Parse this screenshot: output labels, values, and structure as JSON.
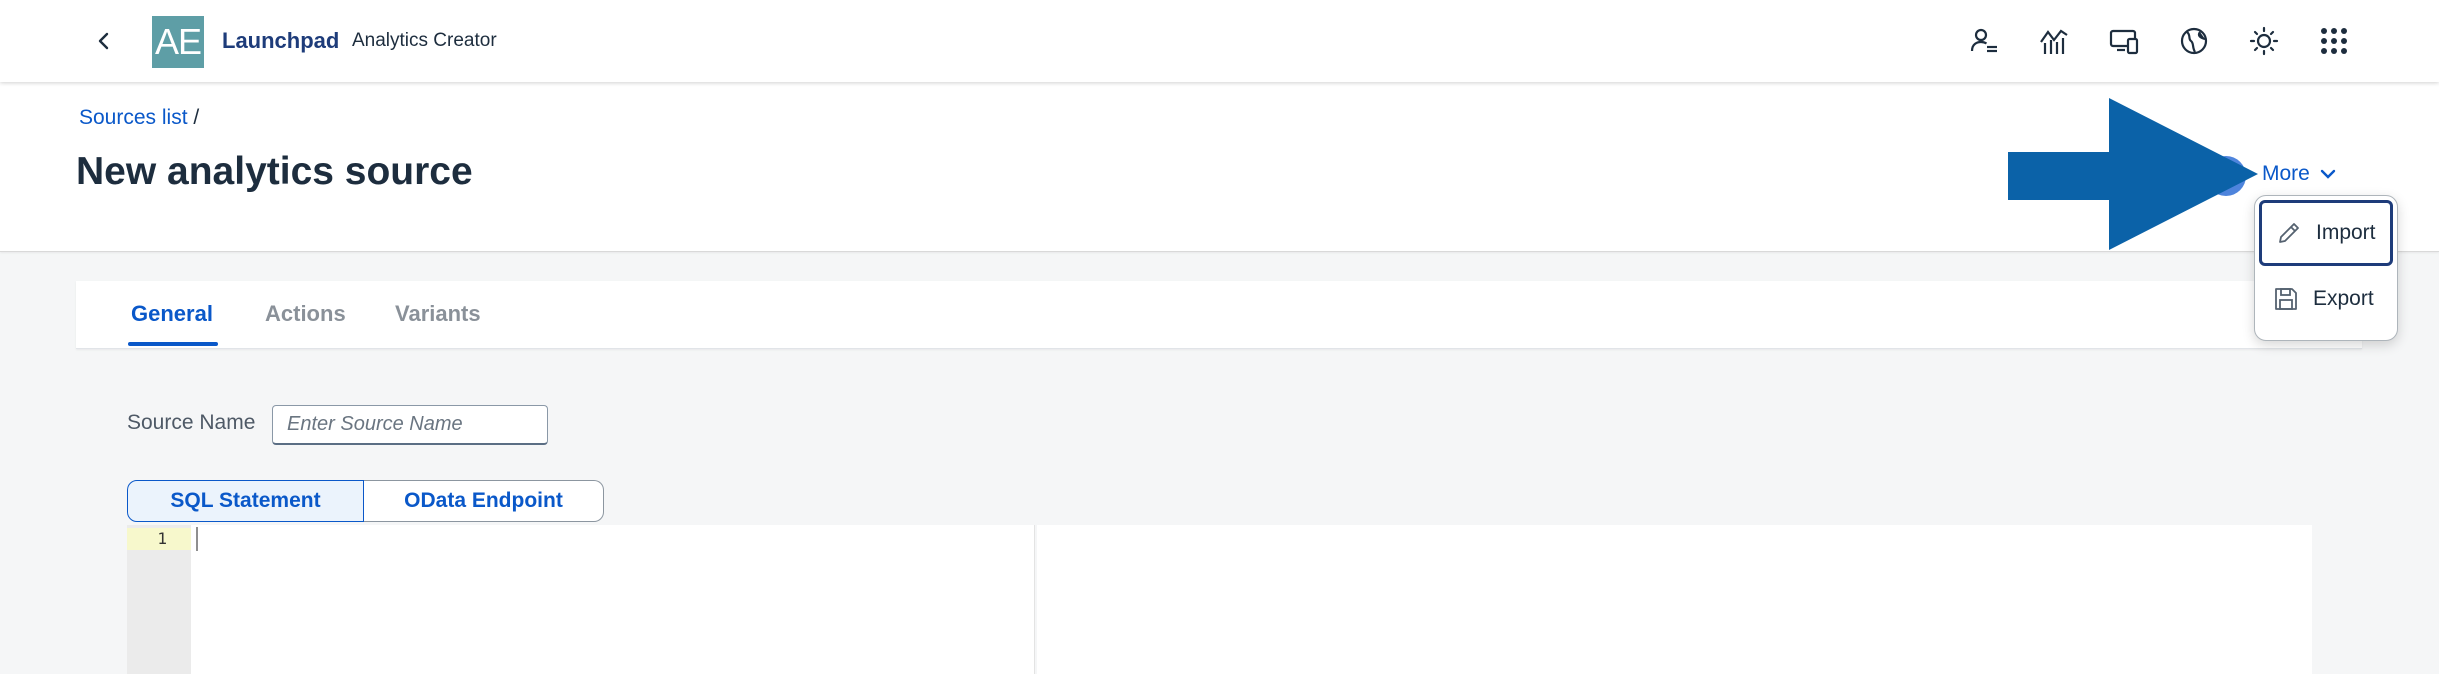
{
  "shell": {
    "logo_text": "AE",
    "product": "Launchpad",
    "subproduct": "Analytics Creator",
    "actions": [
      {
        "icon": "user-list-icon"
      },
      {
        "icon": "analytics-chart-icon"
      },
      {
        "icon": "devices-icon"
      },
      {
        "icon": "globe-icon"
      },
      {
        "icon": "theme-sun-icon"
      },
      {
        "icon": "app-grid-icon"
      }
    ]
  },
  "header": {
    "breadcrumb_link": "Sources list",
    "breadcrumb_sep": "/",
    "title": "New analytics source",
    "more_label": "More"
  },
  "menu": {
    "items": [
      {
        "label": "Import",
        "icon": "pencil-icon"
      },
      {
        "label": "Export",
        "icon": "save-icon"
      }
    ]
  },
  "tabs": [
    {
      "label": "General",
      "active": true
    },
    {
      "label": "Actions",
      "active": false
    },
    {
      "label": "Variants",
      "active": false
    }
  ],
  "form": {
    "source_name_label": "Source Name",
    "source_name_placeholder": "Enter Source Name",
    "source_name_value": ""
  },
  "segmented": {
    "options": [
      "SQL Statement",
      "OData Endpoint"
    ],
    "selected": "SQL Statement"
  },
  "editor": {
    "line_numbers": [
      "1"
    ]
  },
  "colors": {
    "brand_blue": "#0a58c9",
    "shell_title": "#1e3c7a",
    "logo_bg": "#5e9ea6",
    "arrow": "#0b62a8"
  }
}
